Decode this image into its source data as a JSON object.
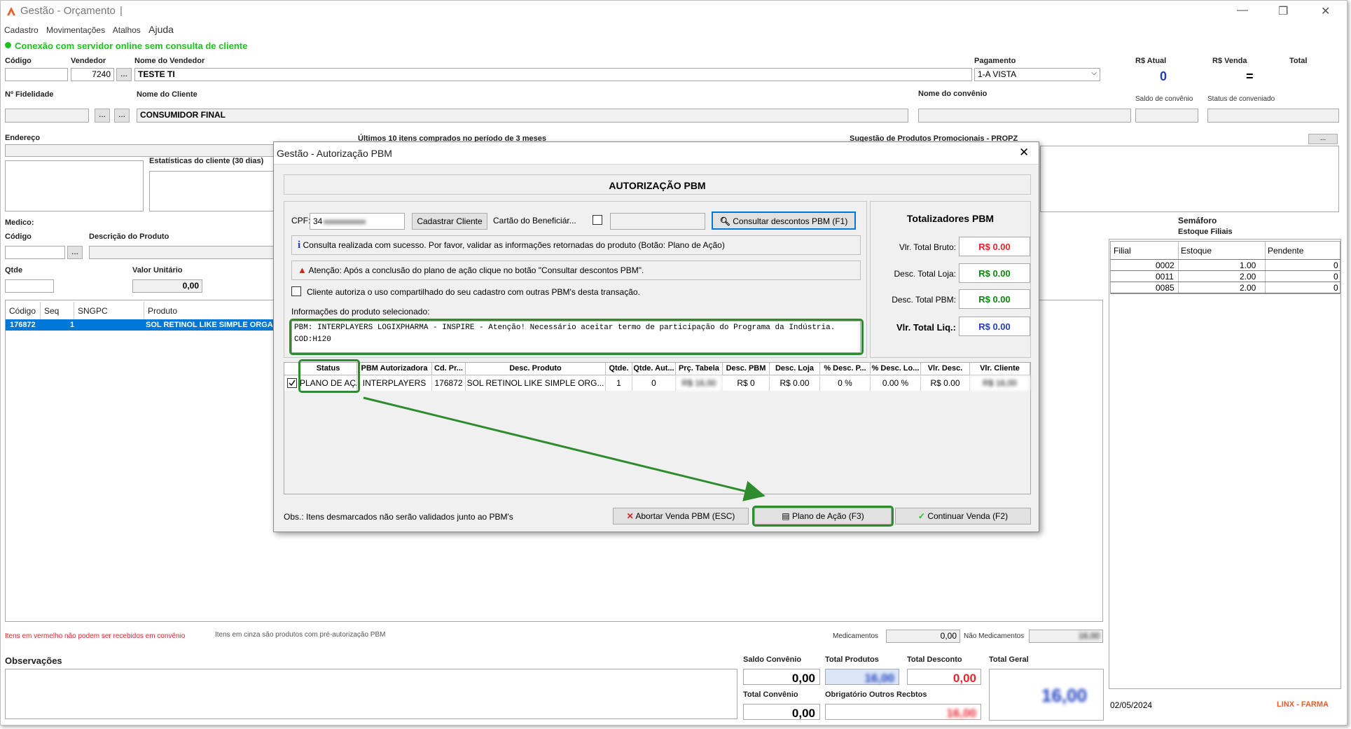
{
  "window": {
    "title": "Gestão - Orçamento",
    "title_sep": "|"
  },
  "menu": [
    "Cadastro",
    "Movimentações",
    "Atalhos",
    "Ajuda"
  ],
  "status": {
    "connection": "Conexão com servidor online sem consulta de cliente",
    "color": "#1dc21d"
  },
  "form": {
    "codigo_label": "Código",
    "vendedor_label": "Vendedor",
    "vendedor_value": "7240",
    "nome_vendedor_label": "Nome do Vendedor",
    "nome_vendedor_value": "TESTE TI",
    "pagamento_label": "Pagamento",
    "pagamento_value": "1-A VISTA",
    "rs_atual_label": "R$ Atual",
    "rs_atual_value": "0",
    "rs_venda_label": "R$ Venda",
    "rs_venda_value": "=",
    "total_label": "Total",
    "fidelidade_label": "Nº Fidelidade",
    "nome_cliente_label": "Nome do Cliente",
    "nome_cliente_value": "CONSUMIDOR FINAL",
    "nome_convenio_label": "Nome do convênio",
    "saldo_convenio_label": "Saldo de convênio",
    "status_conveniado_label": "Status de conveniado",
    "endereco_label": "Endereço",
    "ultimos_itens_label": "Últimos 10 itens comprados no período de 3 meses",
    "sugestao_label": "Sugestão de Produtos Promocionais - PROPZ",
    "estatisticas_label": "Estatísticas do cliente  (30 dias)",
    "medico_label": "Medico:",
    "codigo2_label": "Código",
    "descricao_label": "Descrição do Produto",
    "qtde_label": "Qtde",
    "valor_unitario_label": "Valor Unitário",
    "valor_unitario_value": "0,00",
    "ellipsis": "..."
  },
  "items_table": {
    "headers": [
      "Código",
      "Seq",
      "SNGPC",
      "Produto"
    ],
    "row": [
      "176872",
      "1",
      "",
      "SOL RETINOL LIKE SIMPLE ORGAN"
    ]
  },
  "semaforo": {
    "title": "Semáforo",
    "subtitle": "Estoque Filiais",
    "headers": [
      "Filial",
      "Estoque",
      "Pendente"
    ],
    "rows": [
      [
        "0002",
        "1.00",
        "0"
      ],
      [
        "0011",
        "2.00",
        "0"
      ],
      [
        "0085",
        "2.00",
        "0"
      ]
    ]
  },
  "legend": {
    "red_note": "Itens em vermelho não podem ser recebidos em convênio",
    "gray_note": "Itens em cinza são produtos com pré-autorização PBM",
    "medicamentos_label": "Medicamentos",
    "medicamentos_value": "0,00",
    "nao_medicamentos_label": "Não Medicamentos",
    "nao_medicamentos_value": "16,00"
  },
  "totals": {
    "observacoes_label": "Observações",
    "saldo_convenio_label": "Saldo Convênio",
    "saldo_convenio_value": "0,00",
    "total_produtos_label": "Total Produtos",
    "total_produtos_value": "16,00",
    "total_desconto_label": "Total Desconto",
    "total_desconto_value": "0,00",
    "total_geral_label": "Total Geral",
    "total_geral_value": "16,00",
    "total_convenio_label": "Total Convênio",
    "total_convenio_value": "0,00",
    "obrigatorio_label": "Obrigatório Outros Recbtos",
    "obrigatorio_value": "16,00",
    "date": "02/05/2024",
    "brand": "LINX - FARMA"
  },
  "dialog": {
    "title": "Gestão - Autorização PBM",
    "header": "AUTORIZAÇÃO PBM",
    "cpf_label": "CPF:",
    "cpf_value": "34",
    "cadastrar_btn": "Cadastrar Cliente",
    "cartao_label": "Cartão do Beneficiár...",
    "consultar_btn": "Consultar descontos PBM (F1)",
    "info_msg": "Consulta realizada com sucesso. Por favor, validar as informações retornadas do produto (Botão: Plano de Ação)",
    "warn_msg": "Atenção: Após a conclusão do plano de ação clique no botão \"Consultar descontos PBM\".",
    "cliente_autoriza": "Cliente autoriza o uso compartilhado do seu cadastro com outras PBM's desta transação.",
    "info_produto_label": "Informações do produto selecionado:",
    "info_produto_text": "PBM: INTERPLAYERS LOGIXPHARMA - INSPIRE - Atenção! Necessário aceitar termo de participação do Programa da Indústria. COD:H120",
    "totalizadores_title": "Totalizadores PBM",
    "tot_bruto_label": "Vlr. Total Bruto:",
    "tot_bruto_value": "R$ 0.00",
    "desc_loja_label": "Desc. Total Loja:",
    "desc_loja_value": "R$ 0.00",
    "desc_pbm_label": "Desc. Total PBM:",
    "desc_pbm_value": "R$ 0.00",
    "liq_label": "Vlr. Total Liq.:",
    "liq_value": "R$ 0.00",
    "grid_headers": [
      "Status",
      "PBM Autorizadora",
      "Cd. Pr...",
      "Desc. Produto",
      "Qtde.",
      "Qtde. Aut...",
      "Prç. Tabela",
      "Desc. PBM",
      "Desc. Loja",
      "% Desc. P...",
      "% Desc. Lo...",
      "Vlr. Desc.",
      "Vlr. Cliente"
    ],
    "grid_row": [
      "PLANO DE AÇÃO",
      "INTERPLAYERS",
      "176872",
      "SOL RETINOL LIKE SIMPLE ORG...",
      "1",
      "0",
      "R$ 16,00",
      "R$ 0",
      "R$ 0.00",
      "0 %",
      "0.00 %",
      "R$ 0.00",
      "R$ 16,00"
    ],
    "obs": "Obs.: Itens desmarcados não serão validados junto ao PBM's",
    "abortar_btn": "Abortar Venda PBM (ESC)",
    "plano_btn": "Plano de Ação (F3)",
    "continuar_btn": "Continuar Venda (F2)"
  },
  "colors": {
    "red": "#e8232a",
    "green": "#0a8a0a",
    "blue": "#1f3fbf",
    "highlight": "#2e8b2e",
    "selection": "#0078d7"
  }
}
